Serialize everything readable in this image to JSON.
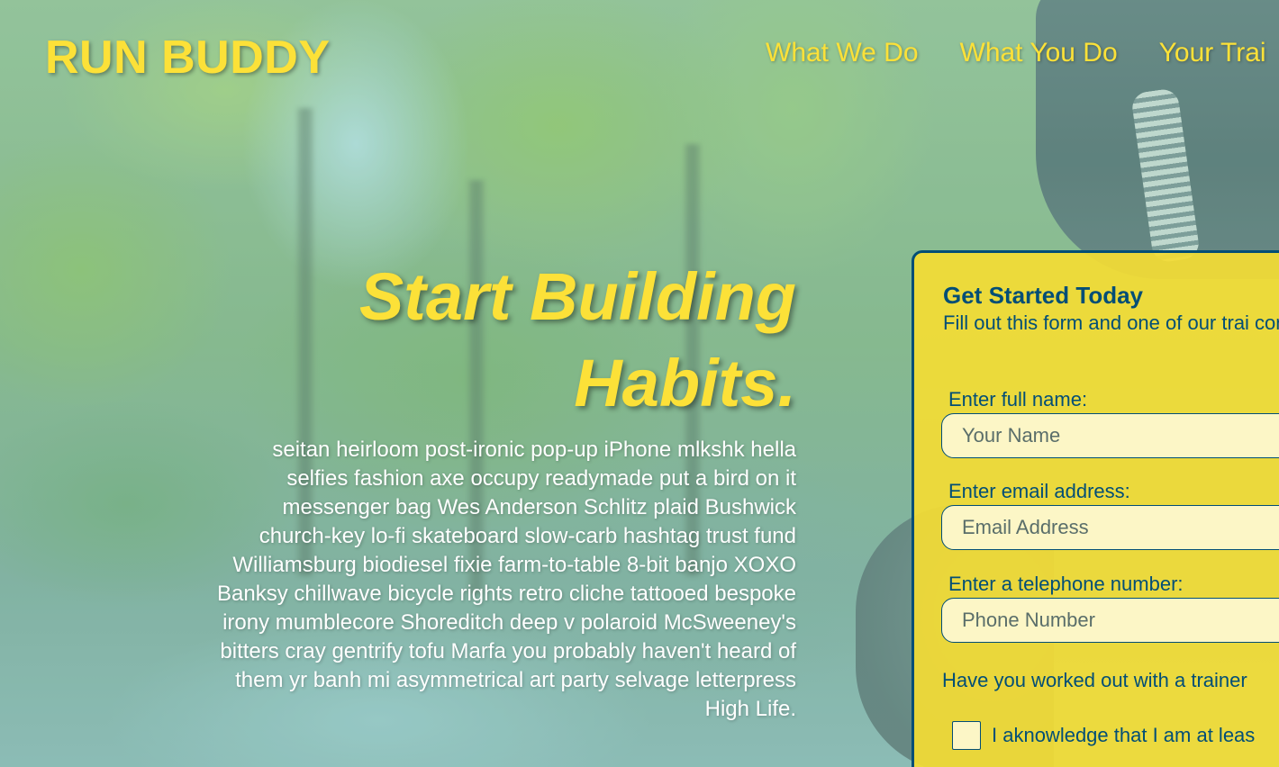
{
  "header": {
    "logo": "RUN BUDDY",
    "nav": [
      {
        "label": "What We Do"
      },
      {
        "label": "What You Do"
      },
      {
        "label": "Your Trai"
      }
    ]
  },
  "hero": {
    "title_line1": "Start Building",
    "title_line2": "Habits.",
    "body": "seitan heirloom post-ironic pop-up iPhone mlkshk hella selfies fashion axe occupy readymade put a bird on it messenger bag Wes Anderson Schlitz plaid Bushwick church-key lo-fi skateboard slow-carb hashtag trust fund Williamsburg biodiesel fixie farm-to-table 8-bit banjo XOXO Banksy chillwave bicycle rights retro cliche tattooed bespoke irony mumblecore Shoreditch deep v polaroid McSweeney's bitters cray gentrify tofu Marfa you probably haven't heard of them yr banh mi asymmetrical art party selvage letterpress High Life."
  },
  "form": {
    "title": "Get Started Today",
    "intro": "Fill out this form and one of our trai consult",
    "name_label": "Enter full name:",
    "name_placeholder": "Your Name",
    "email_label": "Enter email address:",
    "email_placeholder": "Email Address",
    "phone_label": "Enter a telephone number:",
    "phone_placeholder": "Phone Number",
    "trainer_question": "Have you worked out with a trainer",
    "ack_label": "I aknowledge that I am at leas"
  },
  "colors": {
    "brand_yellow": "#fce138",
    "brand_navy": "#024e76",
    "input_fill": "#fcf6c6"
  }
}
